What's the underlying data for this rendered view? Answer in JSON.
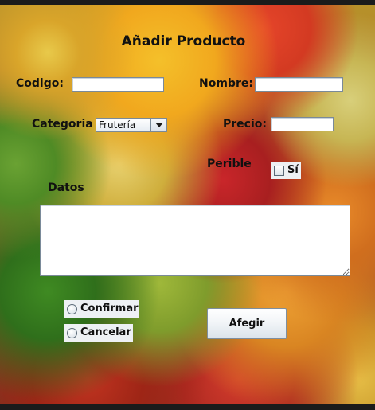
{
  "form": {
    "title": "Añadir Producto",
    "codigo_label": "Codigo:",
    "codigo_value": "",
    "nombre_label": "Nombre:",
    "nombre_value": "",
    "categoria_label": "Categoria",
    "categoria_selected": "Frutería",
    "precio_label": "Precio:",
    "precio_value": "",
    "perible_label": "Perible",
    "perible_checkbox_label": "Sí",
    "perible_checked": false,
    "datos_label": "Datos",
    "datos_value": "",
    "confirmar_label": "Confirmar",
    "cancelar_label": "Cancelar",
    "add_button_label": "Afegir"
  }
}
